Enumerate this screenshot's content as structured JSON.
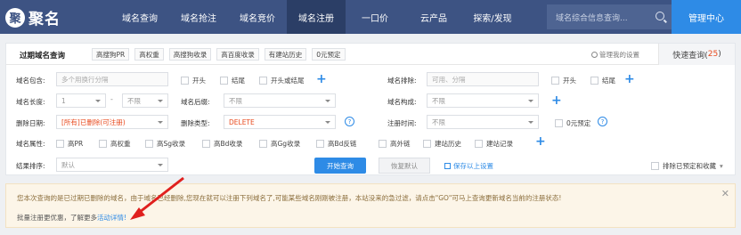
{
  "nav": {
    "logo_mark": "聚",
    "logo_text": "聚名",
    "items": [
      "域名查询",
      "域名抢注",
      "域名竞价",
      "域名注册",
      "一口价",
      "云产品",
      "探索/发现"
    ],
    "active_index": 3,
    "search_placeholder": "域名综合信息查询...",
    "user_center": "管理中心"
  },
  "panel": {
    "title": "过期域名查询",
    "presets": [
      "高搜狗PR",
      "高权重",
      "高搜狗收录",
      "高百度收录",
      "有建站历史",
      "0元预定"
    ],
    "manage_label": "管理我的设置",
    "quick_tab_label": "快速查询(",
    "quick_tab_count": "25",
    "quick_tab_close": ")"
  },
  "filters": {
    "contain_label": "域名包含:",
    "contain_placeholder": "多个用换行分隔",
    "contain_opts": [
      "开头",
      "结尾",
      "开头或结尾"
    ],
    "exclude_label": "域名排除:",
    "exclude_placeholder": "可用、分隔",
    "exclude_opts": [
      "开头",
      "结尾"
    ],
    "length_label": "域名长度:",
    "length_min": "1",
    "length_max": "不限",
    "suffix_label": "域名后缀:",
    "suffix_value": "不限",
    "compose_label": "域名构成:",
    "compose_value": "不限",
    "delete_date_label": "删除日期:",
    "delete_date_value": "[所有]已删除(可注册)",
    "delete_type_label": "删除类型:",
    "delete_type_value": "DELETE",
    "reg_time_label": "注册时间:",
    "reg_time_value": "不限",
    "zero_preorder": "0元预定",
    "attr_label": "域名属性:",
    "attrs": [
      "高PR",
      "高权重",
      "高Sg收录",
      "高Bd收录",
      "高Gg收录",
      "高Bd反链",
      "高外链",
      "建站历史",
      "建站记录"
    ],
    "sort_label": "结果排序:",
    "sort_value": "默认",
    "search_button": "开始查询",
    "reset_button": "恢复默认",
    "save_label": "保存以上设置",
    "exclude_preorder": "排除已预定和收藏"
  },
  "notice": {
    "text": "您本次查询的是已过期已删除的域名，由于域名已经删除,您现在就可以注册下列域名了,可能某些域名刚刚被注册，本站没来的急过滤，请点击\"GO\"可马上查询更新域名当前的注册状态!",
    "batch_text": "批量注册更优惠，了解更多",
    "batch_link": "活动详情!"
  }
}
